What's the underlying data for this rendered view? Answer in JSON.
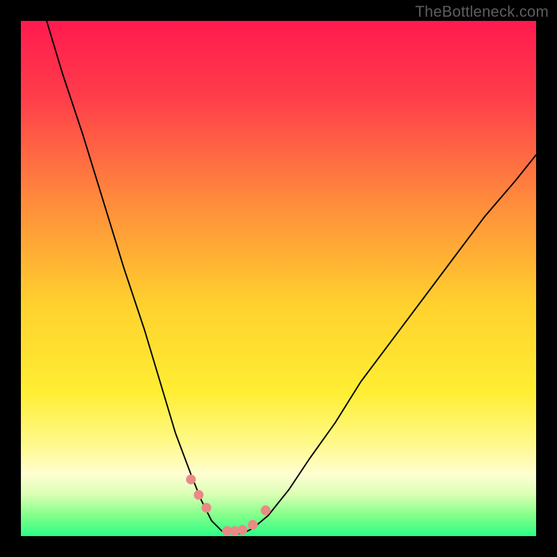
{
  "watermark": "TheBottleneck.com",
  "chart_data": {
    "type": "line",
    "title": "",
    "xlabel": "",
    "ylabel": "",
    "xlim": [
      0,
      100
    ],
    "ylim": [
      0,
      100
    ],
    "background_gradient_stops": [
      {
        "offset": 0.0,
        "color": "#ff1a4f"
      },
      {
        "offset": 0.15,
        "color": "#ff3e4a"
      },
      {
        "offset": 0.35,
        "color": "#ff8b3c"
      },
      {
        "offset": 0.55,
        "color": "#ffd12e"
      },
      {
        "offset": 0.72,
        "color": "#ffee33"
      },
      {
        "offset": 0.82,
        "color": "#fff98a"
      },
      {
        "offset": 0.88,
        "color": "#fffed2"
      },
      {
        "offset": 0.92,
        "color": "#d9ffb3"
      },
      {
        "offset": 0.96,
        "color": "#82ff8a"
      },
      {
        "offset": 1.0,
        "color": "#2bff86"
      }
    ],
    "series": [
      {
        "name": "bottleneck-curve",
        "stroke": "#000000",
        "stroke_width": 2,
        "x": [
          5,
          8,
          12,
          16,
          20,
          24,
          27,
          30,
          33,
          35,
          37,
          39,
          41,
          43,
          45,
          48,
          52,
          56,
          61,
          66,
          72,
          78,
          84,
          90,
          96,
          100
        ],
        "y": [
          100,
          90,
          78,
          65,
          52,
          40,
          30,
          20,
          12,
          7,
          3,
          1,
          0.5,
          0.5,
          1.5,
          4,
          9,
          15,
          22,
          30,
          38,
          46,
          54,
          62,
          69,
          74
        ]
      }
    ],
    "highlight_segments": [
      {
        "name": "pink-dots",
        "color": "#e98a86",
        "radius": 7,
        "x": [
          33,
          34.5,
          36,
          40,
          41.5,
          43,
          45,
          47.5
        ],
        "y": [
          11,
          8,
          5.5,
          1,
          1,
          1.2,
          2.2,
          5
        ]
      }
    ]
  }
}
